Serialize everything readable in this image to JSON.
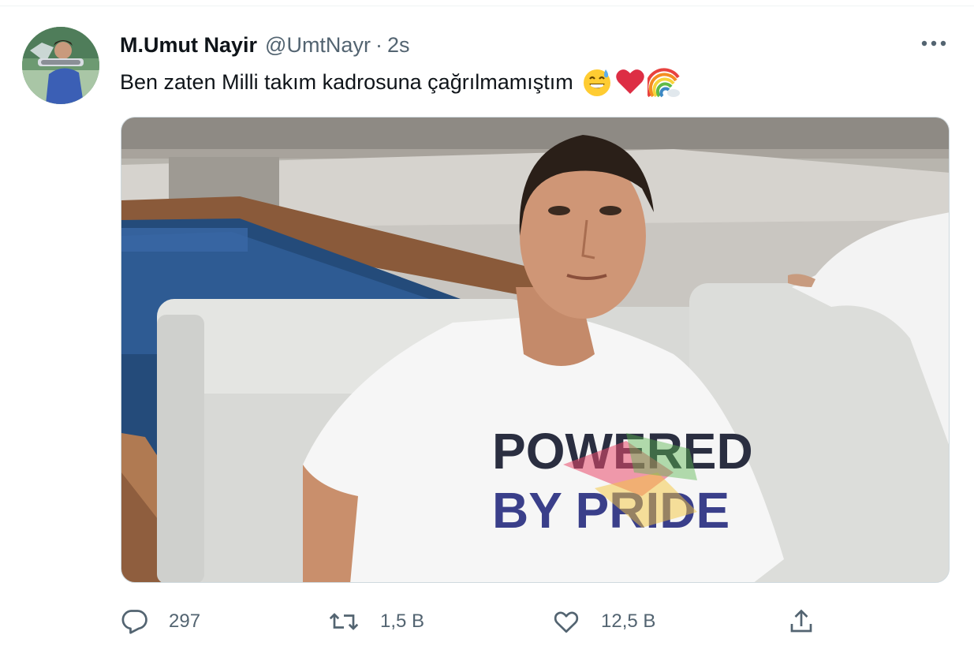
{
  "tweet": {
    "display_name": "M.Umut Nayir",
    "handle": "@UmtNayr",
    "separator": "·",
    "time": "2s",
    "text": "Ben zaten Milli takım kadrosuna çağrılmamıştım",
    "emojis": [
      "grinning-sweat-emoji",
      "red-heart-emoji",
      "rainbow-emoji"
    ]
  },
  "media": {
    "shirt_line1": "POWERED",
    "shirt_line2": "BY PRIDE"
  },
  "actions": {
    "reply_count": "297",
    "retweet_count": "1,5 B",
    "like_count": "12,5 B"
  },
  "icons": {
    "more": "more-horizontal-icon",
    "reply": "reply-bubble-icon",
    "retweet": "retweet-icon",
    "like": "heart-icon",
    "share": "share-upload-icon"
  },
  "colors": {
    "text_primary": "#0f1419",
    "text_secondary": "#536471",
    "border": "#cfd9de"
  }
}
